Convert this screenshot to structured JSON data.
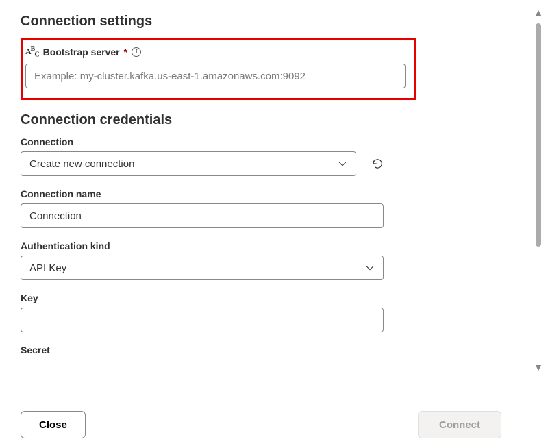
{
  "sections": {
    "settings_heading": "Connection settings",
    "credentials_heading": "Connection credentials"
  },
  "bootstrap": {
    "label": "Bootstrap server",
    "placeholder": "Example: my-cluster.kafka.us-east-1.amazonaws.com:9092",
    "value": "",
    "required_marker": "*"
  },
  "connection": {
    "label": "Connection",
    "selected": "Create new connection"
  },
  "connection_name": {
    "label": "Connection name",
    "value": "Connection"
  },
  "auth_kind": {
    "label": "Authentication kind",
    "selected": "API Key"
  },
  "key": {
    "label": "Key",
    "value": ""
  },
  "secret": {
    "label": "Secret"
  },
  "buttons": {
    "close": "Close",
    "connect": "Connect"
  },
  "icons": {
    "abc": "ABC",
    "info": "i"
  }
}
